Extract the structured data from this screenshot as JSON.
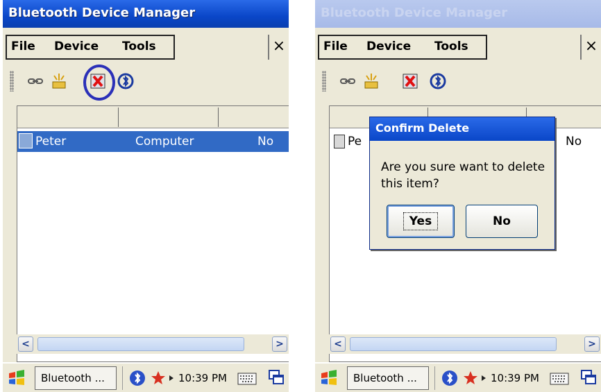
{
  "app": {
    "title": "Bluetooth Device Manager"
  },
  "menu": {
    "file": "File",
    "device": "Device",
    "tools": "Tools",
    "close_glyph": "×"
  },
  "toolbar": {
    "icons": [
      "connect-icon",
      "discover-icon",
      "delete-icon",
      "bluetooth-refresh-icon"
    ],
    "highlighted": "delete-icon"
  },
  "list": {
    "columns": [
      "",
      "",
      ""
    ],
    "rows": [
      {
        "name": "Peter",
        "type": "Computer",
        "paired": "No"
      }
    ],
    "partial_name_right": "Pe"
  },
  "dialog": {
    "title": "Confirm Delete",
    "message": "Are you sure want to delete this item?",
    "yes_label": "Yes",
    "no_label": "No"
  },
  "taskbar": {
    "task_label": "Bluetooth ...",
    "clock": "10:39 PM",
    "icons": [
      "start-icon",
      "bluetooth-tray-icon",
      "network-tray-icon",
      "keyboard-icon",
      "window-switch-icon"
    ]
  },
  "colors": {
    "titlebar": "#0a46c8",
    "selection": "#316ac5",
    "highlight_ring": "#2b30b8",
    "window_bg": "#ece9d8"
  }
}
